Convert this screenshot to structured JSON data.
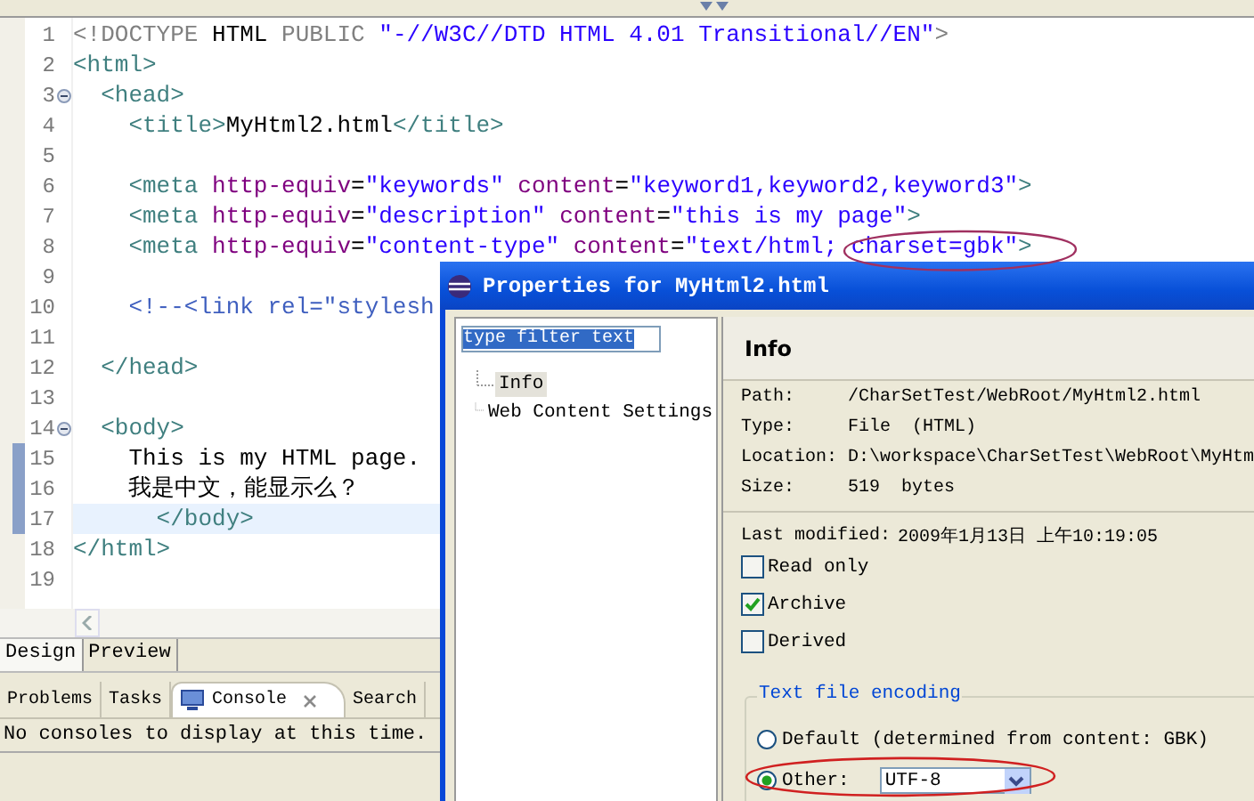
{
  "editor": {
    "lines": [
      {
        "number": "1",
        "tokens": [
          {
            "kind": "doctype",
            "text": "<!DOCTYPE "
          },
          {
            "kind": "text",
            "text": "HTML "
          },
          {
            "kind": "doctype",
            "text": "PUBLIC "
          },
          {
            "kind": "value",
            "text": "\"-//W3C//DTD HTML 4.01 Transitional//EN\""
          },
          {
            "kind": "doctype",
            "text": ">"
          }
        ]
      },
      {
        "number": "2",
        "tokens": [
          {
            "kind": "tag",
            "text": "<html>"
          }
        ]
      },
      {
        "number": "3",
        "expanded": true,
        "tokens": [
          {
            "kind": "tag",
            "text": "  <head>"
          }
        ]
      },
      {
        "number": "4",
        "tokens": [
          {
            "kind": "tag",
            "text": "    <title>"
          },
          {
            "kind": "text",
            "text": "MyHtml2.html"
          },
          {
            "kind": "tag",
            "text": "</title>"
          }
        ]
      },
      {
        "number": "5"
      },
      {
        "number": "6",
        "tokens": [
          {
            "kind": "tag",
            "text": "    <meta"
          },
          {
            "kind": "attr",
            "text": " http-equiv"
          },
          {
            "kind": "text",
            "text": "="
          },
          {
            "kind": "value",
            "text": "\"keywords\""
          },
          {
            "kind": "attr",
            "text": " content"
          },
          {
            "kind": "text",
            "text": "="
          },
          {
            "kind": "value",
            "text": "\"keyword1,keyword2,keyword3\""
          },
          {
            "kind": "tag",
            "text": ">"
          }
        ]
      },
      {
        "number": "7",
        "tokens": [
          {
            "kind": "tag",
            "text": "    <meta"
          },
          {
            "kind": "attr",
            "text": " http-equiv"
          },
          {
            "kind": "text",
            "text": "="
          },
          {
            "kind": "value",
            "text": "\"description\""
          },
          {
            "kind": "attr",
            "text": " content"
          },
          {
            "kind": "text",
            "text": "="
          },
          {
            "kind": "value",
            "text": "\"this is my page\""
          },
          {
            "kind": "tag",
            "text": ">"
          }
        ]
      },
      {
        "number": "8",
        "tokens": [
          {
            "kind": "tag",
            "text": "    <meta"
          },
          {
            "kind": "attr",
            "text": " http-equiv"
          },
          {
            "kind": "text",
            "text": "="
          },
          {
            "kind": "value",
            "text": "\"content-type\""
          },
          {
            "kind": "attr",
            "text": " content"
          },
          {
            "kind": "text",
            "text": "="
          },
          {
            "kind": "value",
            "text": "\"text/html; charset=gbk\""
          },
          {
            "kind": "tag",
            "text": ">"
          }
        ]
      },
      {
        "number": "9"
      },
      {
        "number": "10",
        "tokens": [
          {
            "kind": "comment",
            "text": "    <!--<link rel=\"stylesh"
          }
        ]
      },
      {
        "number": "11"
      },
      {
        "number": "12",
        "tokens": [
          {
            "kind": "tag",
            "text": "  </head>"
          }
        ]
      },
      {
        "number": "13"
      },
      {
        "number": "14",
        "expanded": true,
        "tokens": [
          {
            "kind": "tag",
            "text": "  <body>"
          }
        ]
      },
      {
        "number": "15",
        "changed": true,
        "tokens": [
          {
            "kind": "text",
            "text": "    This is my HTML page."
          }
        ]
      },
      {
        "number": "16",
        "changed": true,
        "tokens": [
          {
            "kind": "text",
            "text": "    我是中文，能显示么？"
          }
        ]
      },
      {
        "number": "17",
        "changed": true,
        "current": true,
        "tokens": [
          {
            "kind": "tag",
            "text": "      </body>"
          }
        ]
      },
      {
        "number": "18",
        "tokens": [
          {
            "kind": "tag",
            "text": "</html>"
          }
        ]
      },
      {
        "number": "19"
      }
    ]
  },
  "editor_tabs": [
    {
      "label": "Design",
      "selected": true
    },
    {
      "label": "Preview",
      "selected": false
    }
  ],
  "panel_tabs": [
    {
      "label": "Problems",
      "selected": false
    },
    {
      "label": "Tasks",
      "selected": false
    },
    {
      "label": "Console",
      "selected": true
    },
    {
      "label": "Search",
      "selected": false
    }
  ],
  "console_message": "No consoles to display at this time.",
  "dialog": {
    "title": "Properties for MyHtml2.html",
    "filter": {
      "value": "type filter text"
    },
    "tree": [
      {
        "label": "Info",
        "selected": true
      },
      {
        "label": "Web Content Settings",
        "selected": false
      }
    ],
    "page_title": "Info",
    "properties": [
      {
        "label": "Path:",
        "value": "/CharSetTest/WebRoot/MyHtml2.html"
      },
      {
        "label": "Type:",
        "value": "File  (HTML)"
      },
      {
        "label": "Location:",
        "value": "D:\\workspace\\CharSetTest\\WebRoot\\MyHtm"
      },
      {
        "label": "Size:",
        "value": "519  bytes"
      }
    ],
    "last_modified": {
      "label": "Last modified:",
      "value": "2009年1月13日 上午10:19:05"
    },
    "attributes": [
      {
        "label": "Read only",
        "checked": false
      },
      {
        "label": "Archive",
        "checked": true
      },
      {
        "label": "Derived",
        "checked": false
      }
    ],
    "encoding": {
      "title": "Text file encoding",
      "options": [
        {
          "kind": "default",
          "label": "Default (determined from content: GBK)",
          "selected": false
        },
        {
          "kind": "other",
          "label": "Other:",
          "selected": true,
          "value": "UTF-8"
        }
      ]
    }
  }
}
